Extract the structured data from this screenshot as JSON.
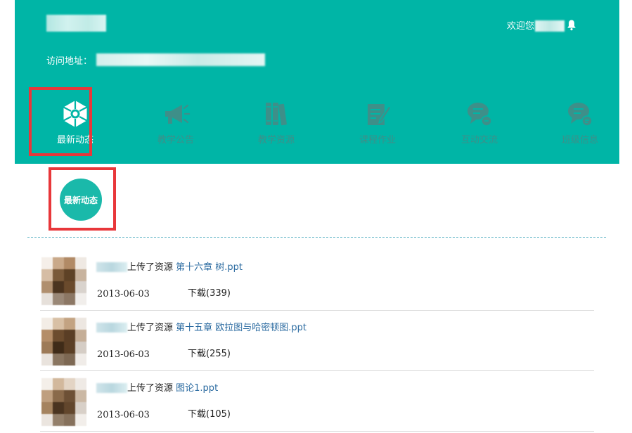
{
  "header": {
    "welcome": "欢迎您",
    "visit_label": "访问地址："
  },
  "nav": [
    {
      "label": "最新动态",
      "icon": "camera-shutter-icon",
      "active": true
    },
    {
      "label": "教学公告",
      "icon": "megaphone-icon",
      "active": false
    },
    {
      "label": "教学资源",
      "icon": "books-icon",
      "active": false
    },
    {
      "label": "课程作业",
      "icon": "homework-edit-icon",
      "active": false
    },
    {
      "label": "互动交流",
      "icon": "chat-bubble-icon",
      "active": false
    },
    {
      "label": "班级信息",
      "icon": "class-info-bubble-icon",
      "active": false
    }
  ],
  "section": {
    "title": "最新动态"
  },
  "feed": [
    {
      "action": "上传了资源",
      "resource": "第十六章 树.ppt",
      "date": "2013-06-03",
      "downloads": "下载(339)"
    },
    {
      "action": "上传了资源",
      "resource": "第十五章 欧拉图与哈密顿图.ppt",
      "date": "2013-06-03",
      "downloads": "下载(255)"
    },
    {
      "action": "上传了资源",
      "resource": "图论1.ppt",
      "date": "2013-06-03",
      "downloads": "下载(105)"
    }
  ],
  "colors": {
    "brand": "#00b5a6",
    "nav_icon": "#3e8f89",
    "highlight": "#e8373a",
    "link": "#2a6aa0"
  }
}
